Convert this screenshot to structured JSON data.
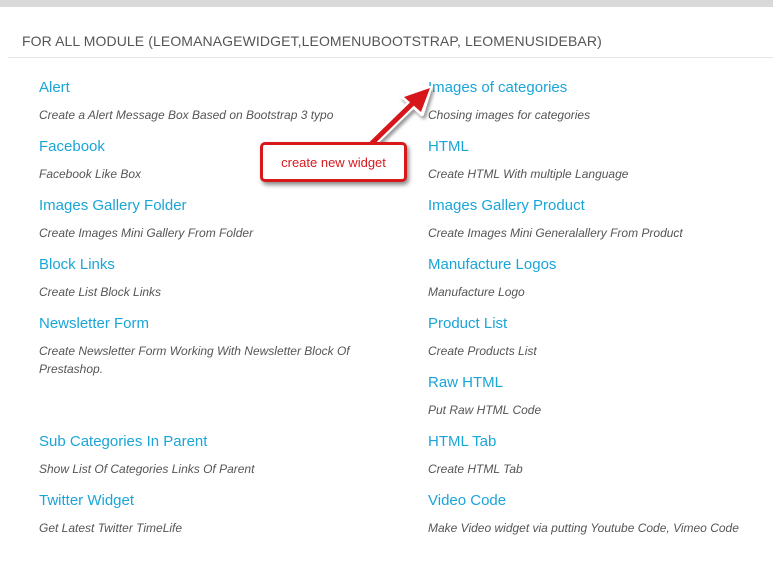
{
  "heading": "FOR ALL MODULE (LEOMANAGEWIDGET,LEOMENUBOOTSTRAP, LEOMENUSIDEBAR)",
  "annotation": {
    "text": "create new widget",
    "color": "#d7191c"
  },
  "accent_color": "#1aa5d8",
  "left_widgets": [
    {
      "title": "Alert",
      "description": "Create a Alert Message Box Based on Bootstrap 3 typo"
    },
    {
      "title": "Facebook",
      "description": "Facebook Like Box"
    },
    {
      "title": "Images Gallery Folder",
      "description": "Create Images Mini Gallery From Folder"
    },
    {
      "title": "Block Links",
      "description": "Create List Block Links"
    },
    {
      "title": "Newsletter Form",
      "description": "Create Newsletter Form Working With Newsletter Block Of Prestashop."
    },
    {
      "title": "Sub Categories In Parent",
      "description": "Show List Of Categories Links Of Parent"
    },
    {
      "title": "Twitter Widget",
      "description": "Get Latest Twitter TimeLife"
    }
  ],
  "right_widgets": [
    {
      "title": "Images of categories",
      "description": "Chosing images for categories"
    },
    {
      "title": "HTML",
      "description": "Create HTML With multiple Language"
    },
    {
      "title": "Images Gallery Product",
      "description": "Create Images Mini Generalallery From Product"
    },
    {
      "title": "Manufacture Logos",
      "description": "Manufacture Logo"
    },
    {
      "title": "Product List",
      "description": "Create Products List"
    },
    {
      "title": "Raw HTML",
      "description": "Put Raw HTML Code"
    },
    {
      "title": "HTML Tab",
      "description": "Create HTML Tab"
    },
    {
      "title": "Video Code",
      "description": "Make Video widget via putting Youtube Code, Vimeo Code"
    }
  ]
}
